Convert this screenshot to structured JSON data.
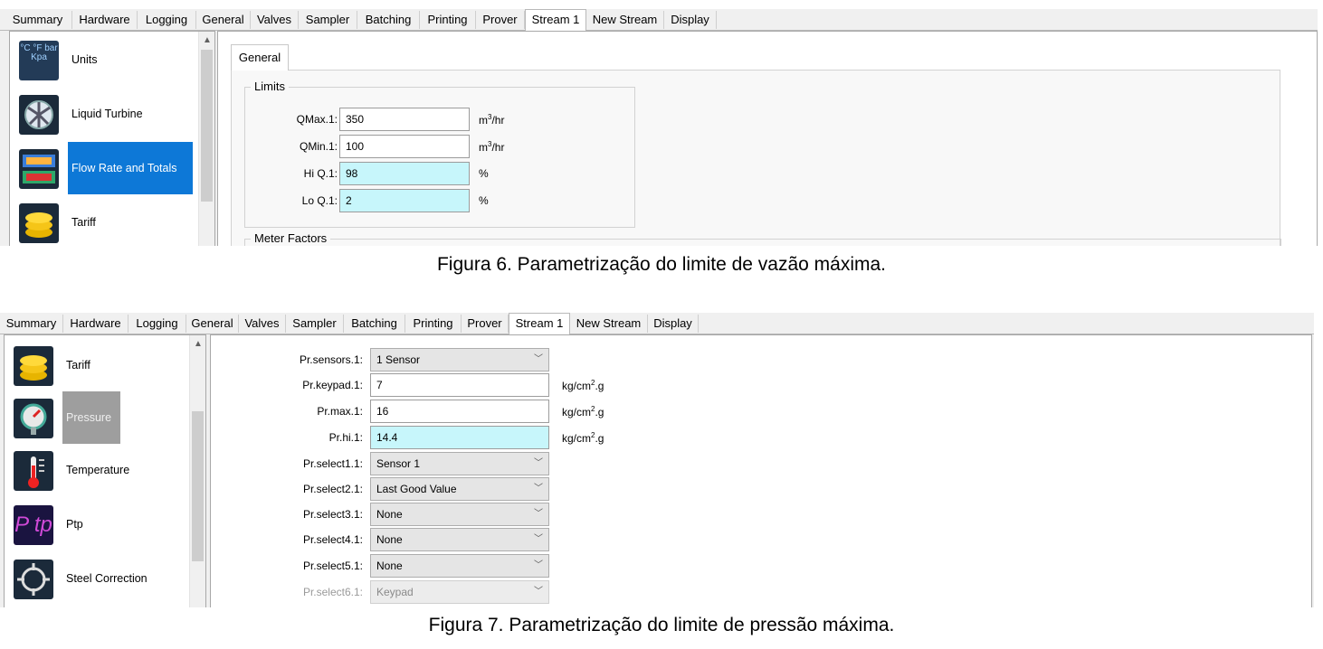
{
  "tabs": [
    "Summary",
    "Hardware",
    "Logging",
    "General",
    "Valves",
    "Sampler",
    "Batching",
    "Printing",
    "Prover",
    "Stream 1",
    "New Stream",
    "Display"
  ],
  "active_tab": "Stream 1",
  "fig6": {
    "nav": [
      {
        "label": "Units",
        "icon": "units-icon",
        "icon_text": "°C  °F  bar  Kpa"
      },
      {
        "label": "Liquid Turbine",
        "icon": "turbine-icon"
      },
      {
        "label": "Flow Rate and Totals",
        "icon": "flow-rate-icon",
        "selected": true
      },
      {
        "label": "Tariff",
        "icon": "coins-icon"
      }
    ],
    "subtab": "General",
    "group_limits": "Limits",
    "group_meter": "Meter Factors",
    "fields": [
      {
        "label": "QMax.1:",
        "value": "350",
        "unit": "m",
        "unit_sup": "3",
        "unit_rest": "/hr",
        "highlight": false
      },
      {
        "label": "QMin.1:",
        "value": "100",
        "unit": "m",
        "unit_sup": "3",
        "unit_rest": "/hr",
        "highlight": false
      },
      {
        "label": "Hi Q.1:",
        "value": "98",
        "unit": "%",
        "unit_sup": "",
        "unit_rest": "",
        "highlight": true
      },
      {
        "label": "Lo Q.1:",
        "value": "2",
        "unit": "%",
        "unit_sup": "",
        "unit_rest": "",
        "highlight": true
      }
    ],
    "caption": "Figura 6. Parametrização do limite de vazão máxima."
  },
  "fig7": {
    "nav": [
      {
        "label": "Tariff",
        "icon": "coins-icon"
      },
      {
        "label": "Pressure",
        "icon": "pressure-gauge-icon",
        "selected": true
      },
      {
        "label": "Temperature",
        "icon": "thermometer-icon"
      },
      {
        "label": "Ptp",
        "icon": "ptp-icon",
        "icon_text": "P tp"
      },
      {
        "label": "Steel Correction",
        "icon": "steel-correction-icon"
      }
    ],
    "rows": [
      {
        "label": "Pr.sensors.1:",
        "type": "combo",
        "value": "1 Sensor"
      },
      {
        "label": "Pr.keypad.1:",
        "type": "input",
        "value": "7",
        "unit": "kg/cm",
        "unit_sup": "2",
        "unit_rest": ".g"
      },
      {
        "label": "Pr.max.1:",
        "type": "input",
        "value": "16",
        "unit": "kg/cm",
        "unit_sup": "2",
        "unit_rest": ".g"
      },
      {
        "label": "Pr.hi.1:",
        "type": "input",
        "value": "14.4",
        "unit": "kg/cm",
        "unit_sup": "2",
        "unit_rest": ".g",
        "highlight": true
      },
      {
        "label": "Pr.select1.1:",
        "type": "combo",
        "value": "Sensor 1"
      },
      {
        "label": "Pr.select2.1:",
        "type": "combo",
        "value": "Last Good Value"
      },
      {
        "label": "Pr.select3.1:",
        "type": "combo",
        "value": "None"
      },
      {
        "label": "Pr.select4.1:",
        "type": "combo",
        "value": "None"
      },
      {
        "label": "Pr.select5.1:",
        "type": "combo",
        "value": "None"
      },
      {
        "label": "Pr.select6.1:",
        "type": "combo",
        "value": "Keypad",
        "disabled": true
      }
    ],
    "caption": "Figura 7. Parametrização do limite de pressão máxima."
  },
  "colors": {
    "selected": "#0d78d7",
    "highlight": "#c7f6fb",
    "pressure_selected": "#9e9e9e"
  }
}
